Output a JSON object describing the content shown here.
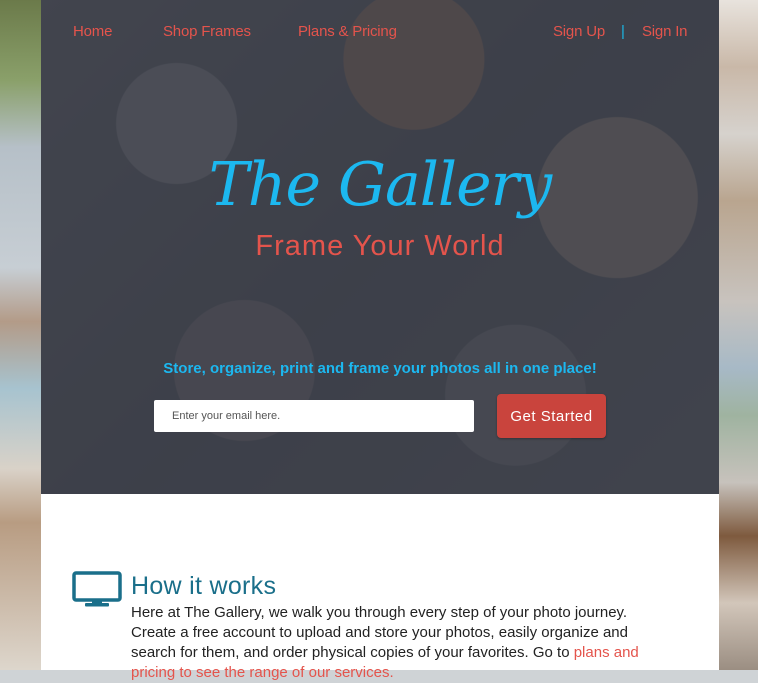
{
  "nav": {
    "home": "Home",
    "shop_frames": "Shop Frames",
    "plans_pricing": "Plans & Pricing",
    "sign_up": "Sign Up",
    "separator": "|",
    "sign_in": "Sign In"
  },
  "hero": {
    "title": "The Gallery",
    "subtitle": "Frame Your World",
    "tagline": "Store, organize, print and frame your photos all in one place!",
    "email_placeholder": "Enter your email here.",
    "cta_label": "Get Started"
  },
  "how_it_works": {
    "icon": "monitor-icon",
    "title": "How it works",
    "text": "Here at The Gallery, we walk you through every step of your photo journey. Create a free account to upload and store your photos, easily organize and search for them, and order physical copies of your favorites. Go to ",
    "link_text": "plans and pricing to see the range of our services."
  },
  "colors": {
    "accent_red": "#e4544c",
    "accent_blue": "#1cb8f0",
    "button_red": "#c9443d",
    "heading_teal": "#1a6f8a"
  }
}
